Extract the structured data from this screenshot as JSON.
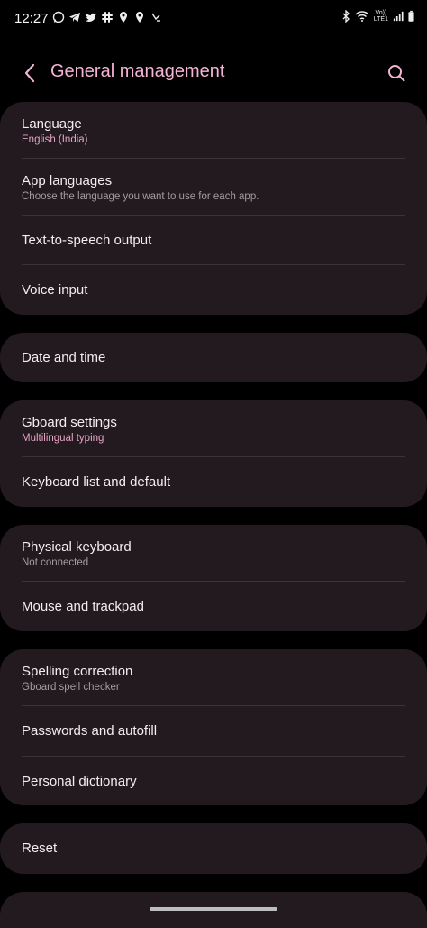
{
  "status_bar": {
    "time": "12:27",
    "left_icons": [
      "whatsapp-icon",
      "telegram-icon",
      "twitter-icon",
      "slack-icon",
      "location-icon",
      "location-icon",
      "missed-call-icon"
    ],
    "right_icons": [
      "bluetooth-icon",
      "wifi-icon",
      "volte-icon",
      "signal-icon",
      "battery-icon"
    ],
    "volte_text_1": "Vo))",
    "volte_text_2": "LTE1"
  },
  "header": {
    "title": "General management",
    "back_icon": "chevron-left-icon",
    "search_icon": "search-icon",
    "accent_color": "#f4b4d4"
  },
  "groups": [
    {
      "items": [
        {
          "title": "Language",
          "subtitle": "English (India)",
          "subtitle_style": "accent"
        },
        {
          "title": "App languages",
          "subtitle": "Choose the language you want to use for each app.",
          "subtitle_style": "muted"
        },
        {
          "title": "Text-to-speech output"
        },
        {
          "title": "Voice input"
        }
      ]
    },
    {
      "items": [
        {
          "title": "Date and time"
        }
      ]
    },
    {
      "items": [
        {
          "title": "Gboard settings",
          "subtitle": "Multilingual typing",
          "subtitle_style": "accent"
        },
        {
          "title": "Keyboard list and default"
        }
      ]
    },
    {
      "items": [
        {
          "title": "Physical keyboard",
          "subtitle": "Not connected",
          "subtitle_style": "muted"
        },
        {
          "title": "Mouse and trackpad"
        }
      ]
    },
    {
      "items": [
        {
          "title": "Spelling correction",
          "subtitle": "Gboard spell checker",
          "subtitle_style": "muted"
        },
        {
          "title": "Passwords and autofill"
        },
        {
          "title": "Personal dictionary"
        }
      ]
    },
    {
      "items": [
        {
          "title": "Reset"
        }
      ]
    }
  ]
}
